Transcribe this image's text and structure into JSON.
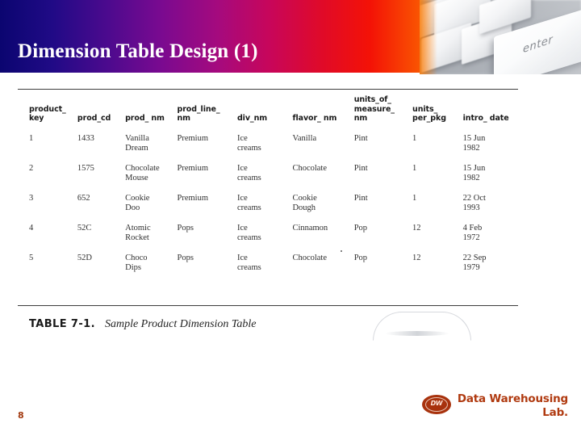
{
  "slide": {
    "title": "Dimension Table Design (1)",
    "page_number": "8"
  },
  "header": {
    "photo_key_label": "enter",
    "gradient_start": "#0b0570",
    "gradient_end": "#fb6a00"
  },
  "figure": {
    "caption_label": "TABLE 7-1.",
    "caption_text": "Sample Product Dimension Table",
    "columns": [
      "product_\nkey",
      "prod_cd",
      "prod_\nnm",
      "prod_line_\nnm",
      "div_nm",
      "flavor_\nnm",
      "units_of_\nmeasure_\nnm",
      "units_\nper_pkg",
      "intro_\ndate"
    ],
    "rows": [
      {
        "product_key": "1",
        "prod_cd": "1433",
        "prod_nm": "Vanilla\nDream",
        "prod_line_nm": "Premium",
        "div_nm": "Ice\ncreams",
        "flavor_nm": "Vanilla",
        "units_of_measure_nm": "Pint",
        "units_per_pkg": "1",
        "intro_date": "15 Jun\n1982"
      },
      {
        "product_key": "2",
        "prod_cd": "1575",
        "prod_nm": "Chocolate\nMouse",
        "prod_line_nm": "Premium",
        "div_nm": "Ice\ncreams",
        "flavor_nm": "Chocolate",
        "units_of_measure_nm": "Pint",
        "units_per_pkg": "1",
        "intro_date": "15 Jun\n1982"
      },
      {
        "product_key": "3",
        "prod_cd": "652",
        "prod_nm": "Cookie\nDoo",
        "prod_line_nm": "Premium",
        "div_nm": "Ice\ncreams",
        "flavor_nm": "Cookie\nDough",
        "units_of_measure_nm": "Pint",
        "units_per_pkg": "1",
        "intro_date": "22 Oct\n1993"
      },
      {
        "product_key": "4",
        "prod_cd": "52C",
        "prod_nm": "Atomic\nRocket",
        "prod_line_nm": "Pops",
        "div_nm": "Ice\ncreams",
        "flavor_nm": "Cinnamon",
        "units_of_measure_nm": "Pop",
        "units_per_pkg": "12",
        "intro_date": "4 Feb\n1972"
      },
      {
        "product_key": "5",
        "prod_cd": "52D",
        "prod_nm": "Choco\nDips",
        "prod_line_nm": "Pops",
        "div_nm": "Ice\ncreams",
        "flavor_nm": "Chocolate",
        "units_of_measure_nm": "Pop",
        "units_per_pkg": "12",
        "intro_date": "22 Sep\n1979"
      }
    ]
  },
  "footer": {
    "logo_text": "DW",
    "brand_line1": "Data Warehousing",
    "brand_line2": "Lab.",
    "brand_color": "#b03a10"
  }
}
